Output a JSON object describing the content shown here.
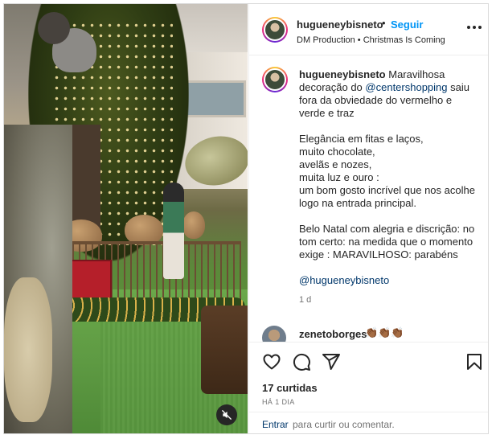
{
  "header": {
    "username": "hugueneybisneto",
    "separator": "•",
    "follow_label": "Seguir",
    "subtitle": "DM Production • Christmas Is Coming",
    "more_icon": "more-options-icon"
  },
  "caption": {
    "username": "hugueneybisneto",
    "text_before_mention": " Maravilhosa decoração do ",
    "mention": "@centershopping",
    "text_after_mention": " saiu fora da obviedade do vermelho e verde e traz\n\nElegância em fitas e laços,\nmuito chocolate,\navelãs e nozes,\nmuita luz e ouro :\num bom gosto incrível que nos acolhe logo na entrada principal.\n\nBelo Natal com alegria e discrição: no tom certo: na medida que o momento exige : MARAVILHOSO: parabéns\n\n",
    "signature": "@hugueneybisneto",
    "time": "1 d"
  },
  "comment": {
    "username": "zenetoborges",
    "text": "👏🏾👏🏾👏🏾"
  },
  "actions": {
    "like_icon": "heart-icon",
    "comment_icon": "comment-icon",
    "share_icon": "share-icon",
    "save_icon": "bookmark-icon"
  },
  "likes": "17 curtidas",
  "posted_ago": "HÁ 1 DIA",
  "add_comment": {
    "login_label": "Entrar",
    "text": "para curtir ou comentar."
  },
  "media": {
    "mute_icon": "speaker-muted-icon"
  },
  "colors": {
    "accent": "#0095f6",
    "link": "#00376b",
    "muted": "#737373"
  }
}
